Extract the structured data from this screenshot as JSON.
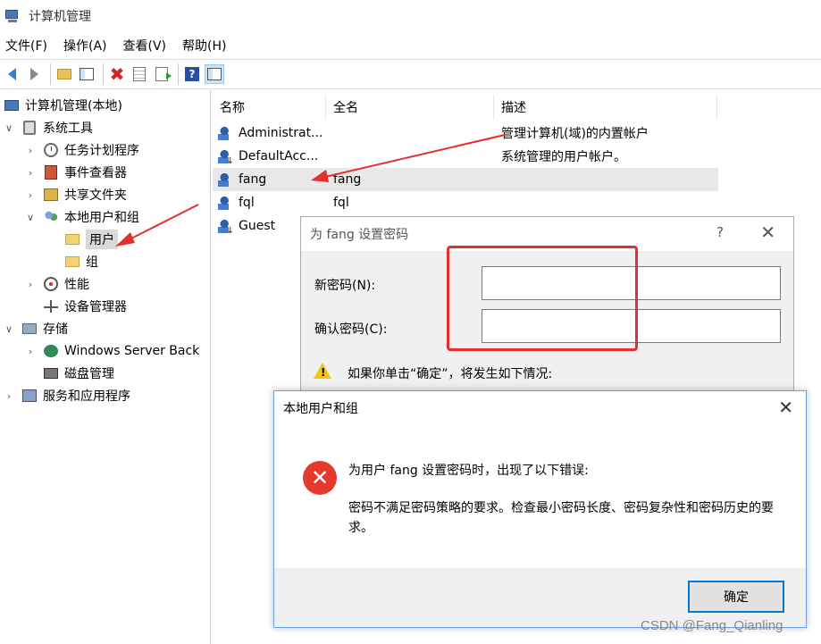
{
  "window": {
    "title": "计算机管理"
  },
  "menu": {
    "file": "文件(F)",
    "action": "操作(A)",
    "view": "查看(V)",
    "help": "帮助(H)"
  },
  "toolbar": {
    "help_glyph": "?"
  },
  "tree": {
    "root": "计算机管理(本地)",
    "system_tools": "系统工具",
    "task_scheduler": "任务计划程序",
    "event_viewer": "事件查看器",
    "shared_folders": "共享文件夹",
    "local_users_groups": "本地用户和组",
    "users": "用户",
    "groups": "组",
    "performance": "性能",
    "device_manager": "设备管理器",
    "storage": "存储",
    "windows_server_backup": "Windows Server Back",
    "disk_management": "磁盘管理",
    "services_apps": "服务和应用程序"
  },
  "list": {
    "headers": {
      "name": "名称",
      "fullname": "全名",
      "description": "描述"
    },
    "rows": [
      {
        "name": "Administrat...",
        "fullname": "",
        "description": "管理计算机(域)的内置帐户"
      },
      {
        "name": "DefaultAcc...",
        "fullname": "",
        "description": "系统管理的用户帐户。"
      },
      {
        "name": "fang",
        "fullname": "fang",
        "description": ""
      },
      {
        "name": "fql",
        "fullname": "fql",
        "description": ""
      },
      {
        "name": "Guest",
        "fullname": "",
        "description": ""
      }
    ]
  },
  "pwd_dialog": {
    "title": "为 fang 设置密码",
    "help_glyph": "?",
    "close_glyph": "✕",
    "new_pwd_label": "新密码(N):",
    "confirm_pwd_label": "确认密码(C):",
    "warning_glyph": "!",
    "warning_text": "如果你单击“确定”，将发生如下情况:"
  },
  "err_dialog": {
    "title": "本地用户和组",
    "close_glyph": "✕",
    "icon_glyph": "✕",
    "msg1": "为用户 fang 设置密码时，出现了以下错误:",
    "msg2": "密码不满足密码策略的要求。检查最小密码长度、密码复杂性和密码历史的要求。",
    "ok_label": "确定"
  },
  "watermark": "CSDN @Fang_Qianling",
  "colors": {
    "annotation_red": "#e52e2e",
    "error_red": "#e43a2e",
    "focus_blue": "#0078d7"
  }
}
